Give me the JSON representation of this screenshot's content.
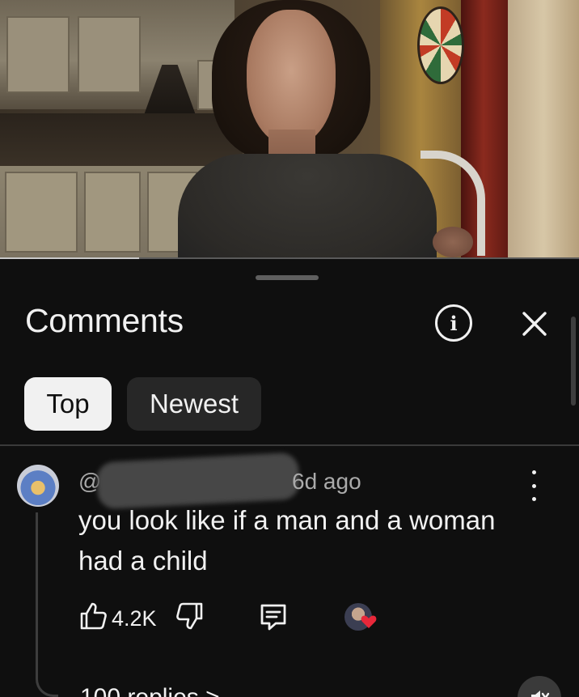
{
  "video": {
    "progress_percent": 24
  },
  "comments_panel": {
    "title": "Comments",
    "sort_chips": [
      {
        "label": "Top",
        "selected": true
      },
      {
        "label": "Newest",
        "selected": false
      }
    ]
  },
  "comment": {
    "author": "@",
    "time": "6d ago",
    "text_line1": "you look like if a man and a woman",
    "text_line2": "had a child",
    "likes": "4.2K",
    "replies_label": "100 replies >",
    "creator_hearted": true
  },
  "colors": {
    "background": "#0f0f0f",
    "chip_selected": "#f1f1f1",
    "chip_unselected": "#272727",
    "secondary_text": "#aaaaaa",
    "heart": "#e8283a"
  }
}
